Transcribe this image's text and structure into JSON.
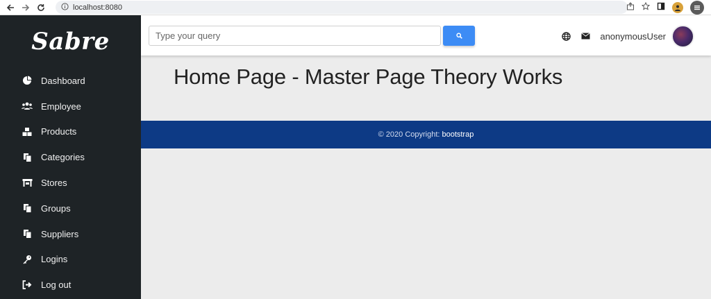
{
  "browser": {
    "url": "localhost:8080"
  },
  "sidebar": {
    "brand": "Sabre",
    "items": [
      {
        "label": "Dashboard",
        "icon": "dashboard-icon"
      },
      {
        "label": "Employee",
        "icon": "users-icon"
      },
      {
        "label": "Products",
        "icon": "boxes-icon"
      },
      {
        "label": "Categories",
        "icon": "copy-icon"
      },
      {
        "label": "Stores",
        "icon": "store-icon"
      },
      {
        "label": "Groups",
        "icon": "copy-icon"
      },
      {
        "label": "Suppliers",
        "icon": "copy-icon"
      },
      {
        "label": "Logins",
        "icon": "key-icon"
      },
      {
        "label": "Log out",
        "icon": "sign-out-icon"
      }
    ]
  },
  "header": {
    "search_placeholder": "Type your query",
    "username": "anonymousUser"
  },
  "main": {
    "title": "Home Page - Master Page Theory Works"
  },
  "footer": {
    "copyright": "© 2020 Copyright:",
    "link": "bootstrap"
  },
  "colors": {
    "sidebar": "#1e2326",
    "footer": "#0d3a85",
    "search_button": "#3d8cf5",
    "page_background": "#ececec"
  }
}
